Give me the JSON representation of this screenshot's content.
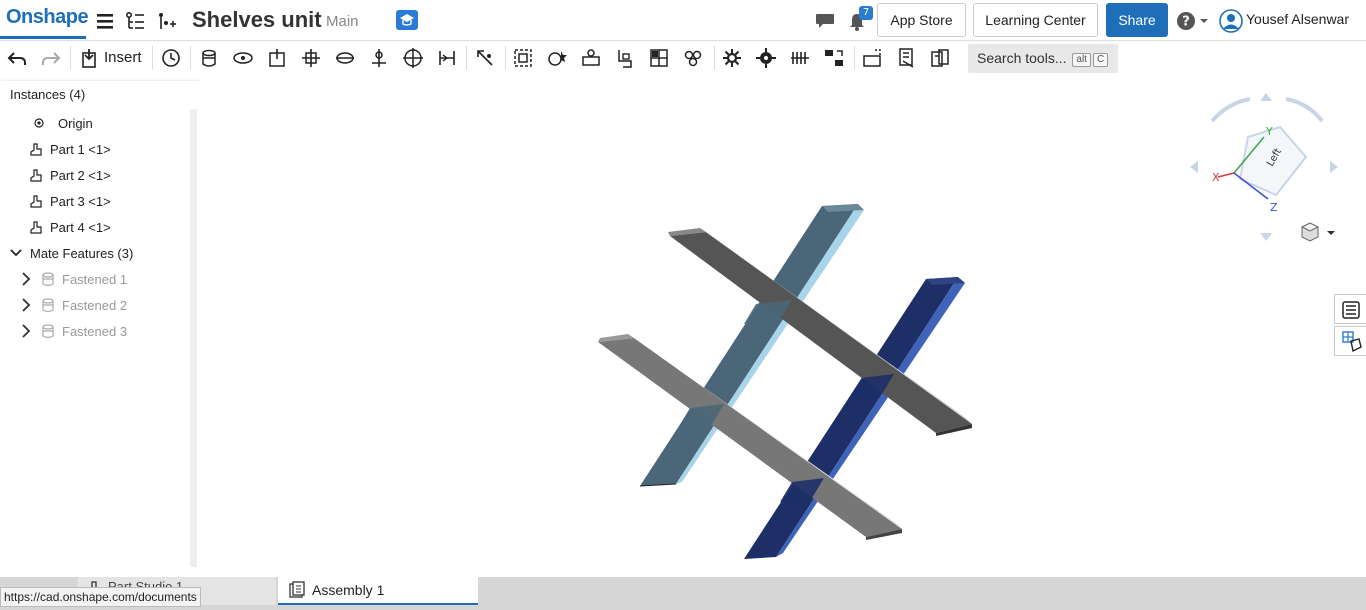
{
  "app": {
    "logo": "Onshape",
    "accent": "#1f6fb8"
  },
  "document": {
    "title": "Shelves unit",
    "branch": "Main"
  },
  "header": {
    "notification_count": "7",
    "app_store": "App Store",
    "learning_center": "Learning Center",
    "share": "Share",
    "user_name": "Yousef Alsenwar"
  },
  "toolbar": {
    "insert_label": "Insert",
    "search_placeholder": "Search tools...",
    "search_kbd1": "alt",
    "search_kbd2": "C"
  },
  "tree": {
    "instances_header": "Instances (4)",
    "origin": "Origin",
    "parts": [
      "Part 1 <1>",
      "Part 2 <1>",
      "Part 3 <1>",
      "Part 4 <1>"
    ],
    "mate_header": "Mate Features (3)",
    "mates": [
      "Fastened 1",
      "Fastened 2",
      "Fastened 3"
    ]
  },
  "viewcube": {
    "face_label": "Left",
    "axis_x": "X",
    "axis_y": "Y",
    "axis_z": "Z"
  },
  "bottom": {
    "tab_partstudio": "Part Studio 1",
    "tab_assembly": "Assembly 1"
  },
  "status": {
    "url": "https://cad.onshape.com/documents"
  },
  "colors": {
    "part_gray": "#777777",
    "part_dark": "#555555",
    "part_slate": "#4a6678",
    "part_navy": "#1d2f66"
  }
}
